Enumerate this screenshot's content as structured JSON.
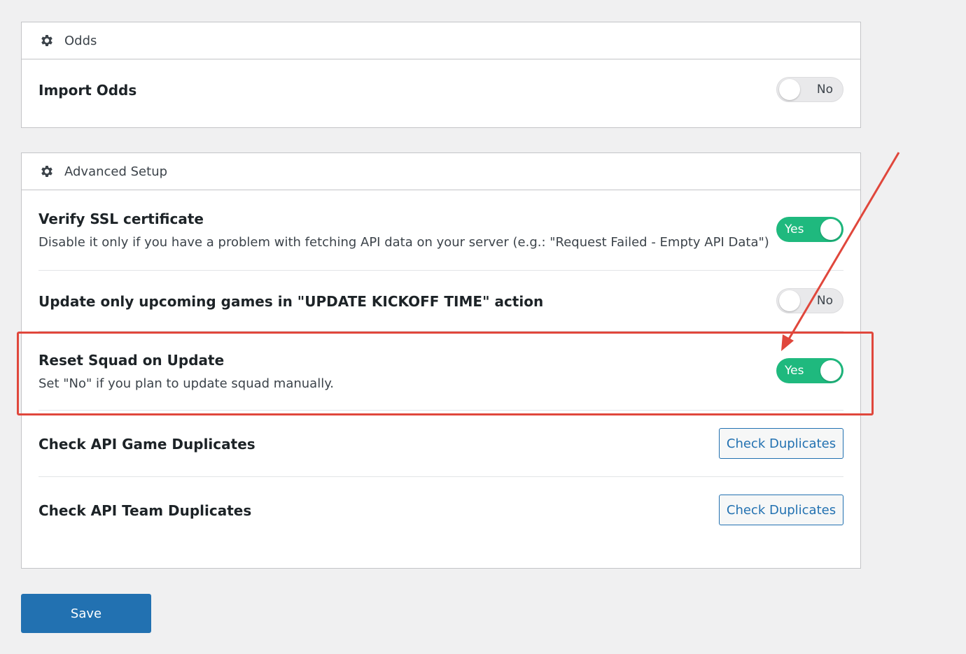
{
  "odds_panel": {
    "header": "Odds",
    "import_odds": {
      "title": "Import Odds",
      "toggle_label": "No"
    }
  },
  "advanced_panel": {
    "header": "Advanced Setup",
    "verify_ssl": {
      "title": "Verify SSL certificate",
      "description": "Disable it only if you have a problem with fetching API data on your server (e.g.: \"Request Failed - Empty API Data\")",
      "toggle_label": "Yes"
    },
    "update_upcoming": {
      "title": "Update only upcoming games in \"UPDATE KICKOFF TIME\" action",
      "toggle_label": "No"
    },
    "reset_squad": {
      "title": "Reset Squad on Update",
      "description": "Set \"No\" if you plan to update squad manually.",
      "toggle_label": "Yes"
    },
    "check_game_duplicates": {
      "title": "Check API Game Duplicates",
      "button_label": "Check Duplicates"
    },
    "check_team_duplicates": {
      "title": "Check API Team Duplicates",
      "button_label": "Check Duplicates"
    }
  },
  "save_button": "Save",
  "icons": {
    "panel_header": "gear-icon"
  },
  "colors": {
    "toggle_on": "#1fb97e",
    "primary": "#2271b1",
    "annotation": "#e0473c"
  }
}
